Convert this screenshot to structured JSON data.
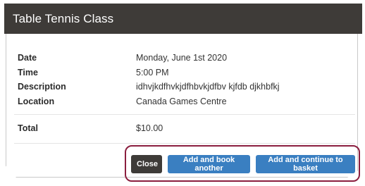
{
  "modal": {
    "title": "Table Tennis Class",
    "details": {
      "date_label": "Date",
      "date_value": "Monday, June 1st 2020",
      "time_label": "Time",
      "time_value": "5:00 PM",
      "description_label": "Description",
      "description_value": "idhvjkdfhvkjdfhbvkjdfbv kjfdb djkhbfkj",
      "location_label": "Location",
      "location_value": "Canada Games Centre",
      "total_label": "Total",
      "total_value": "$10.00"
    },
    "buttons": {
      "close": "Close",
      "add_another": "Add and book another",
      "add_continue": "Add and continue to basket"
    }
  },
  "colors": {
    "header_bg": "#3e3b38",
    "primary_button": "#3a7fc1",
    "highlight_border": "#8b1e3f"
  }
}
